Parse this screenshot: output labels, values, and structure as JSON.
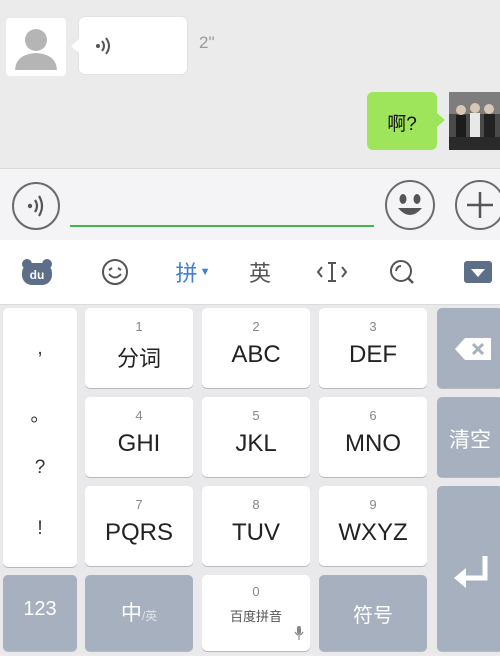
{
  "chat": {
    "received_voice_duration": "2\"",
    "sent_text": "啊?"
  },
  "ime_toolbar": {
    "pinyin_label": "拼",
    "english_label": "英"
  },
  "keyboard": {
    "punctuation": [
      ",",
      "。",
      "?",
      "!"
    ],
    "keys": [
      {
        "num": "1",
        "label": "分词"
      },
      {
        "num": "2",
        "label": "ABC"
      },
      {
        "num": "3",
        "label": "DEF"
      },
      {
        "num": "4",
        "label": "GHI"
      },
      {
        "num": "5",
        "label": "JKL"
      },
      {
        "num": "6",
        "label": "MNO"
      },
      {
        "num": "7",
        "label": "PQRS"
      },
      {
        "num": "8",
        "label": "TUV"
      },
      {
        "num": "9",
        "label": "WXYZ"
      }
    ],
    "clear_label": "清空",
    "num_mode_label": "123",
    "lang_toggle_main": "中",
    "lang_toggle_sub": "/英",
    "space_num": "0",
    "space_label": "百度拼音",
    "symbol_label": "符号"
  },
  "colors": {
    "sent_bubble": "#9fe55b",
    "accent_blue": "#3b7fd6",
    "input_underline": "#42b64a",
    "function_key": "#a7b0be"
  },
  "icons": [
    "person-avatar-icon",
    "voice-wave-icon",
    "voice-mode-icon",
    "emoji-icon",
    "plus-icon",
    "baidu-logo-icon",
    "smiley-icon",
    "cursor-icon",
    "search-icon",
    "collapse-keyboard-icon",
    "backspace-icon",
    "enter-icon",
    "microphone-icon"
  ]
}
